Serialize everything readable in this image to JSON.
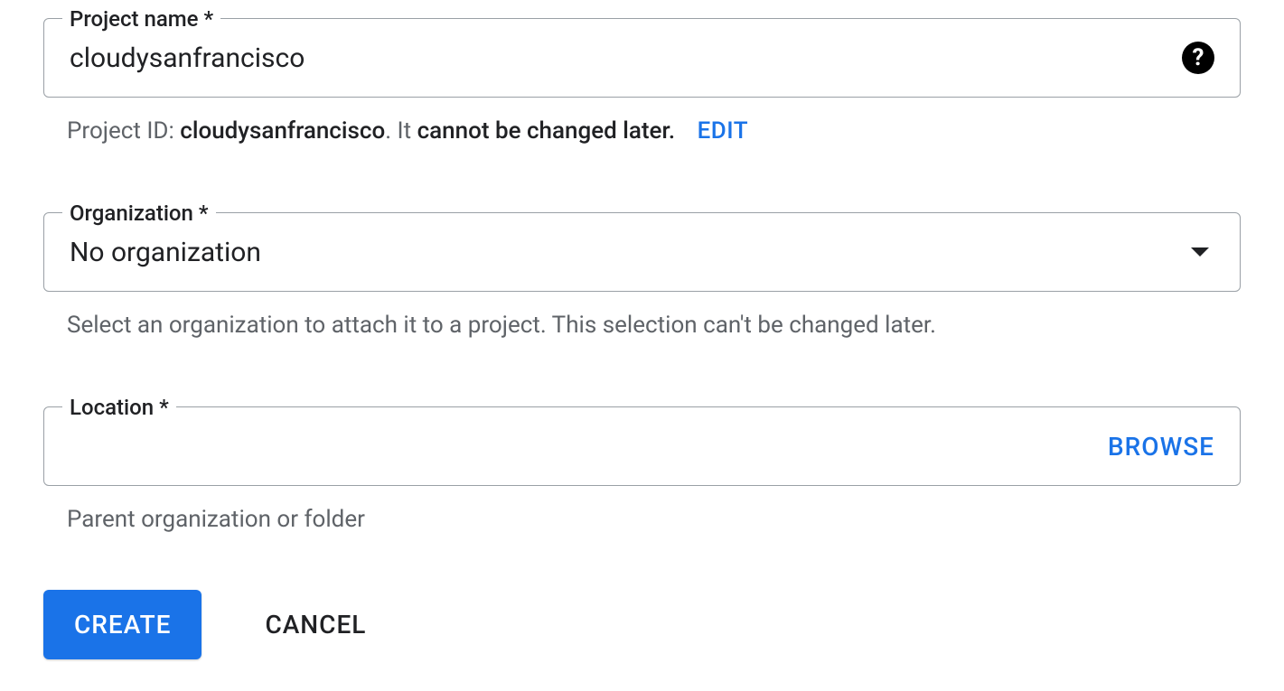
{
  "projectName": {
    "label": "Project name *",
    "value": "cloudysanfrancisco"
  },
  "projectId": {
    "prefix": "Project ID: ",
    "value": "cloudysanfrancisco",
    "suffixPlain": ". It ",
    "suffixBold": "cannot be changed later.",
    "editLabel": "EDIT"
  },
  "organization": {
    "label": "Organization *",
    "value": "No organization",
    "helper": "Select an organization to attach it to a project. This selection can't be changed later."
  },
  "location": {
    "label": "Location *",
    "value": "",
    "browseLabel": "BROWSE",
    "helper": "Parent organization or folder"
  },
  "buttons": {
    "create": "CREATE",
    "cancel": "CANCEL"
  }
}
